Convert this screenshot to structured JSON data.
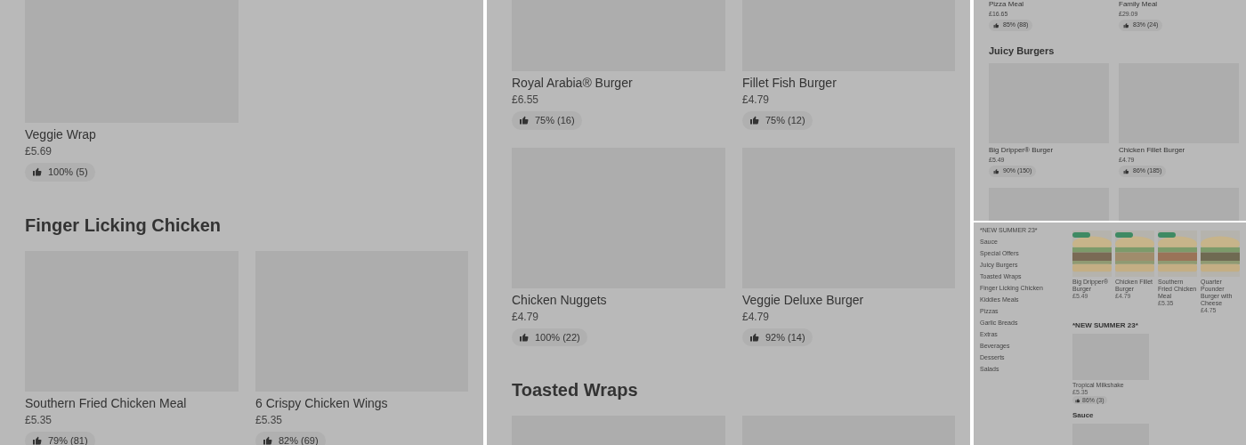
{
  "panels": [
    {
      "kind": "menu",
      "blocks": [
        {
          "kind": "grid",
          "items": [
            {
              "kind": "item",
              "name": "Veggie Wrap",
              "price": "£5.69",
              "rating": "100% (5)"
            }
          ]
        },
        {
          "kind": "heading",
          "text": "Finger Licking Chicken"
        },
        {
          "kind": "grid",
          "items": [
            {
              "kind": "item",
              "name": "Southern Fried Chicken Meal",
              "price": "£5.35",
              "rating": "79% (81)"
            },
            {
              "kind": "item",
              "name": "6 Crispy Chicken Wings",
              "price": "£5.35",
              "rating": "82% (69)"
            }
          ]
        }
      ]
    },
    {
      "kind": "menu",
      "blocks": [
        {
          "kind": "grid",
          "items": [
            {
              "kind": "item",
              "name": "Royal Arabia® Burger",
              "price": "£6.55",
              "rating": "75% (16)"
            },
            {
              "kind": "item",
              "name": "Fillet Fish Burger",
              "price": "£4.79",
              "rating": "75% (12)"
            }
          ]
        },
        {
          "kind": "grid",
          "items": [
            {
              "kind": "item",
              "name": "Chicken Nuggets",
              "price": "£4.79",
              "rating": "100% (22)"
            },
            {
              "kind": "item",
              "name": "Veggie Deluxe Burger",
              "price": "£4.79",
              "rating": "92% (14)"
            }
          ]
        },
        {
          "kind": "heading",
          "text": "Toasted Wraps"
        },
        {
          "kind": "grid"
        }
      ]
    },
    {
      "kind": "menu",
      "blocks": [
        {
          "kind": "grid",
          "items": [
            {
              "kind": "caption",
              "name": "Pizza Meal",
              "price": "£16.65",
              "rating": "85% (88)"
            },
            {
              "kind": "caption",
              "name": "Family Meal",
              "price": "£29.09",
              "rating": "83% (24)"
            }
          ]
        },
        {
          "kind": "heading",
          "text": "Juicy Burgers"
        },
        {
          "kind": "grid",
          "items": [
            {
              "kind": "item",
              "name": "Big Dripper® Burger",
              "price": "£5.49",
              "rating": "90% (150)"
            },
            {
              "kind": "item",
              "name": "Chicken Fillet Burger",
              "price": "£4.79",
              "rating": "86% (185)"
            }
          ]
        },
        {
          "kind": "grid"
        }
      ]
    },
    {
      "kind": "overview",
      "sidebar": [
        "*NEW SUMMER 23*",
        "Sauce",
        "Special Offers",
        "Juicy Burgers",
        "Toasted Wraps",
        "Finger Licking Chicken",
        "Kiddies Meals",
        "Pizzas",
        "Garlic Breads",
        "Extras",
        "Beverages",
        "Desserts",
        "Salads"
      ],
      "popular": [
        {
          "name": "Big Dripper® Burger",
          "price": "£5.49",
          "badge": true
        },
        {
          "name": "Chicken Fillet Burger",
          "price": "£4.79",
          "badge": true
        },
        {
          "name": "Southern Fried Chicken Meal",
          "price": "£5.35",
          "badge": true
        },
        {
          "name": "Quarter Pounder Burger with Cheese",
          "price": "£4.75",
          "badge": false
        }
      ],
      "sections": [
        {
          "title": "*NEW SUMMER 23*",
          "items": [
            {
              "kind": "item",
              "name": "Tropical Milkshake",
              "price": "£5.35",
              "rating": "86% (3)"
            }
          ]
        },
        {
          "title": "Sauce"
        }
      ]
    }
  ]
}
